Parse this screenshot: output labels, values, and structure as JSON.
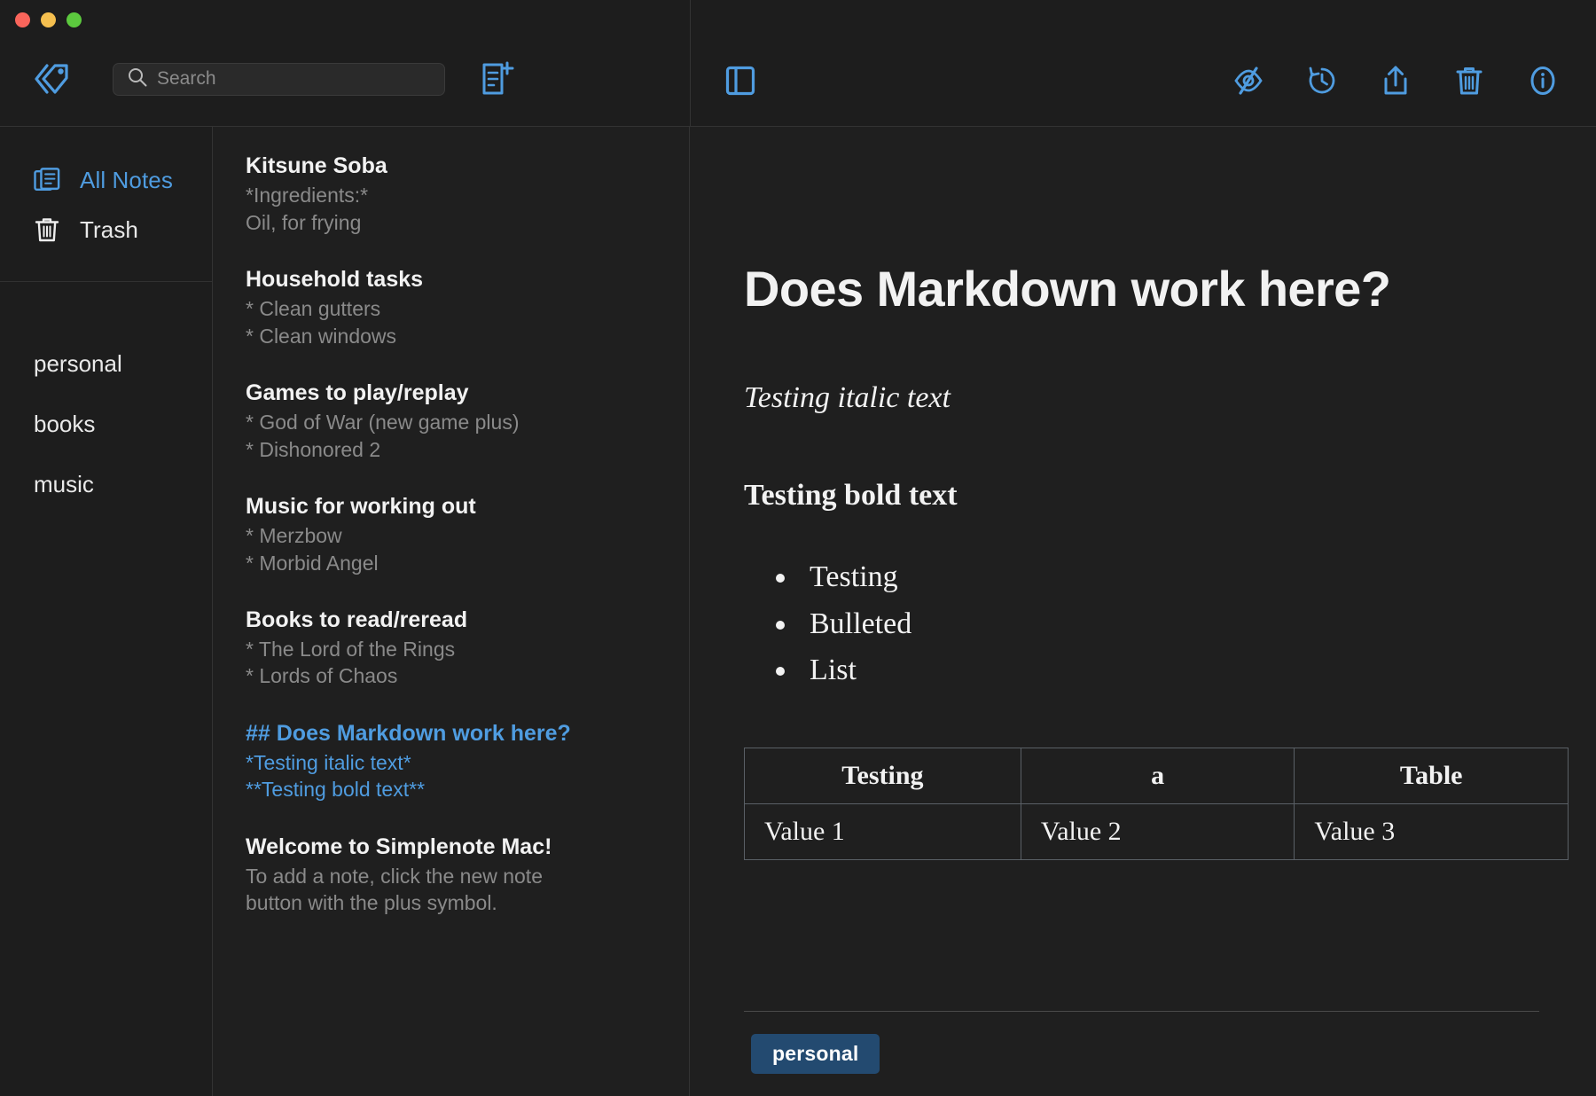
{
  "window": {
    "traffic_lights": [
      "close",
      "minimize",
      "maximize"
    ]
  },
  "toolbar_left": {
    "tag_drawer_icon": "tags-icon",
    "new_note_icon": "new-note-icon"
  },
  "search": {
    "placeholder": "Search",
    "value": "",
    "icon": "search-icon"
  },
  "toolbar_right": {
    "sidebar_toggle_icon": "sidebar-toggle-icon",
    "actions": [
      {
        "name": "markdown-preview-icon",
        "icon": "eye-off-icon"
      },
      {
        "name": "history-icon",
        "icon": "clock-revert-icon"
      },
      {
        "name": "share-icon",
        "icon": "share-upload-icon"
      },
      {
        "name": "trash-icon",
        "icon": "trash-icon"
      },
      {
        "name": "info-icon",
        "icon": "info-circle-icon"
      }
    ]
  },
  "sidebar": {
    "nav": [
      {
        "label": "All Notes",
        "icon": "all-notes-icon",
        "active": true
      },
      {
        "label": "Trash",
        "icon": "trash-icon",
        "active": false
      }
    ],
    "tags": [
      "personal",
      "books",
      "music"
    ]
  },
  "notes": [
    {
      "title": "Kitsune Soba",
      "preview": [
        "*Ingredients:*",
        "Oil, for frying"
      ],
      "selected": false
    },
    {
      "title": "Household tasks",
      "preview": [
        "* Clean gutters",
        "* Clean windows"
      ],
      "selected": false
    },
    {
      "title": "Games to play/replay",
      "preview": [
        "* God of War (new game plus)",
        "* Dishonored 2"
      ],
      "selected": false
    },
    {
      "title": "Music for working out",
      "preview": [
        "* Merzbow",
        "* Morbid Angel"
      ],
      "selected": false
    },
    {
      "title": "Books to read/reread",
      "preview": [
        "* The Lord of the Rings",
        "* Lords of Chaos"
      ],
      "selected": false
    },
    {
      "title": "## Does Markdown work here?",
      "preview": [
        "*Testing italic text*",
        "**Testing bold text**"
      ],
      "selected": true
    },
    {
      "title": "Welcome to Simplenote Mac!",
      "preview": [
        "To add a note, click the new note",
        "button with the plus symbol."
      ],
      "selected": false
    }
  ],
  "editor": {
    "heading": "Does Markdown work here?",
    "italic_text": "Testing italic text",
    "bold_text": "Testing bold text",
    "bullets": [
      "Testing",
      "Bulleted",
      "List"
    ],
    "table": {
      "headers": [
        "Testing",
        "a",
        "Table"
      ],
      "rows": [
        [
          "Value 1",
          "Value 2",
          "Value 3"
        ]
      ]
    },
    "tags": [
      "personal"
    ]
  },
  "colors": {
    "accent": "#4f9ce0",
    "background": "#1f1f1f",
    "chrome": "#1d1d1d",
    "divider": "#333333",
    "text_primary": "#f2f2f2",
    "text_secondary": "#8a8a8a",
    "tag_chip": "#234a70"
  }
}
